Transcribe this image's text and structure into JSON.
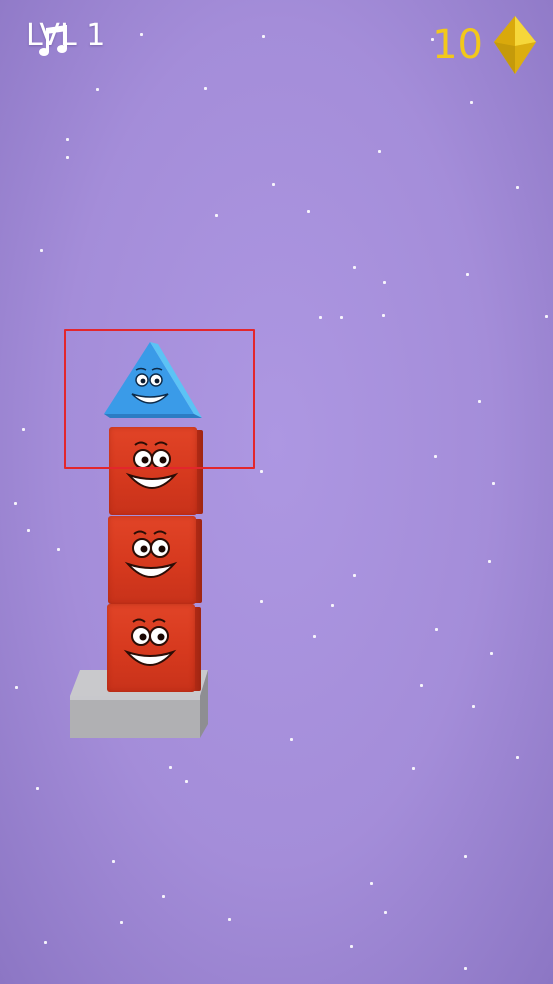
{
  "hud": {
    "level_label": "LVL 1",
    "gem_count": "10",
    "gem_color": "#f2c81a",
    "music_icon": "music-note-icon",
    "gem_icon": "yellow-diamond-icon"
  },
  "colors": {
    "background": "#a48dd9",
    "red_block": "#d6391e",
    "blue_triangle": "#3aa0ea",
    "pedestal": "#b9b9bb",
    "highlight": "#e3262c"
  },
  "stack": {
    "top_piece": "blue-triangle-smiley",
    "blocks": [
      "red-cube-smiley",
      "red-cube-smiley",
      "red-cube-smiley"
    ],
    "base": "grey-pedestal"
  }
}
